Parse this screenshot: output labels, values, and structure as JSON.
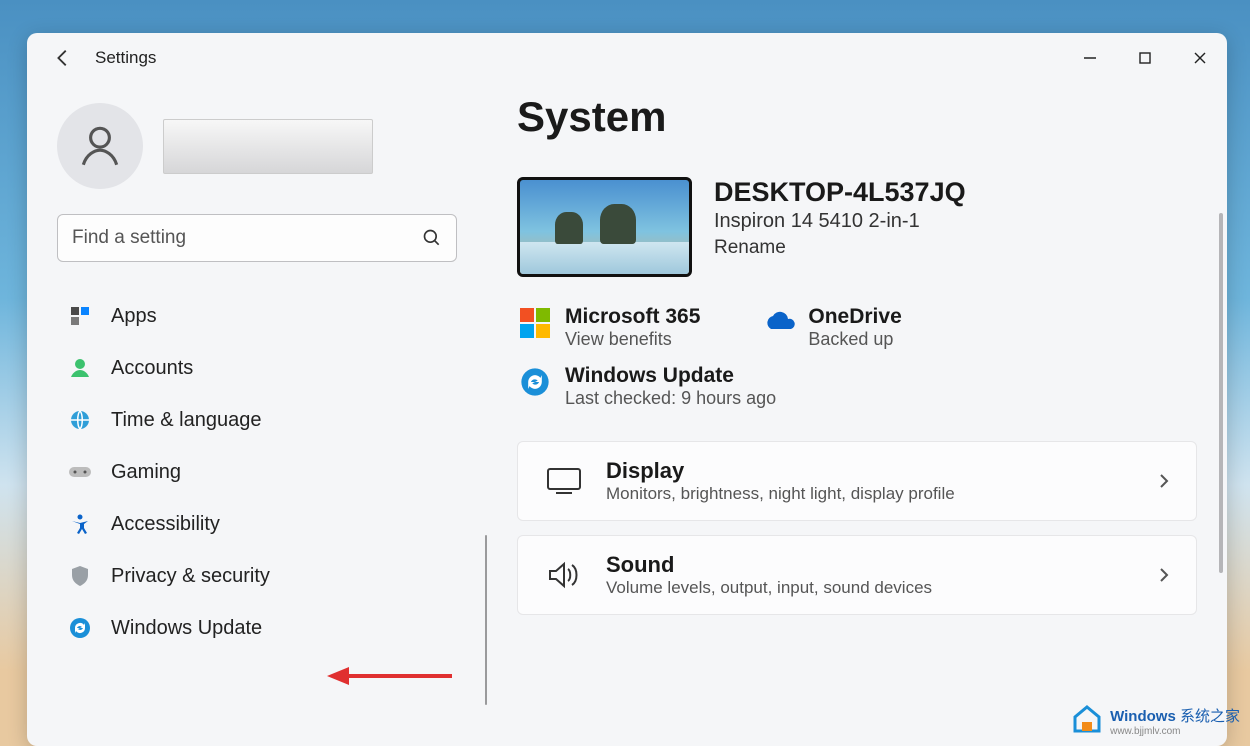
{
  "app_title": "Settings",
  "search_placeholder": "Find a setting",
  "sidebar": {
    "items": [
      {
        "label": "Apps"
      },
      {
        "label": "Accounts"
      },
      {
        "label": "Time & language"
      },
      {
        "label": "Gaming"
      },
      {
        "label": "Accessibility"
      },
      {
        "label": "Privacy & security"
      },
      {
        "label": "Windows Update"
      }
    ]
  },
  "main": {
    "page_title": "System",
    "device_name": "DESKTOP-4L537JQ",
    "device_model": "Inspiron 14 5410 2-in-1",
    "rename": "Rename",
    "status": {
      "ms365_title": "Microsoft 365",
      "ms365_sub": "View benefits",
      "onedrive_title": "OneDrive",
      "onedrive_sub": "Backed up",
      "wu_title": "Windows Update",
      "wu_sub": "Last checked: 9 hours ago"
    },
    "sections": [
      {
        "title": "Display",
        "desc": "Monitors, brightness, night light, display profile"
      },
      {
        "title": "Sound",
        "desc": "Volume levels, output, input, sound devices"
      }
    ]
  },
  "watermark": {
    "brand": "Windows",
    "sub1": "系统之家",
    "sub2": "www.bjjmlv.com"
  }
}
